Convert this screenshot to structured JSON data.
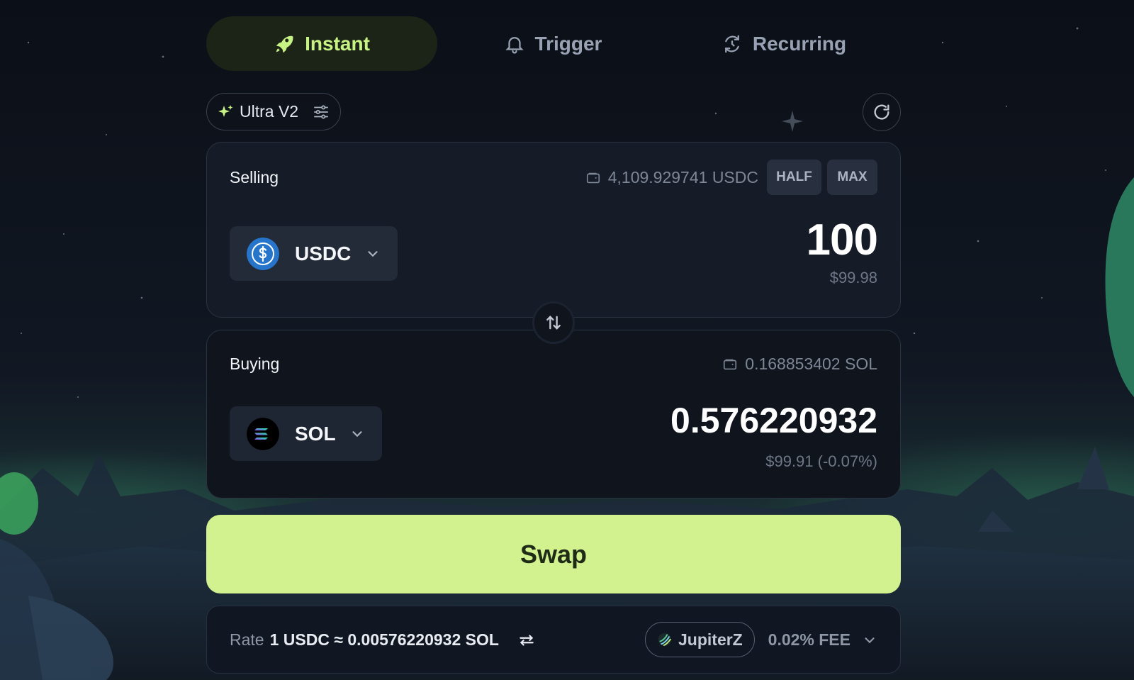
{
  "tabs": [
    {
      "label": "Instant",
      "icon": "rocket-icon",
      "active": true
    },
    {
      "label": "Trigger",
      "icon": "bell-icon",
      "active": false
    },
    {
      "label": "Recurring",
      "icon": "recurring-icon",
      "active": false
    }
  ],
  "mode": {
    "label": "Ultra V2",
    "icon": "sparkle-icon"
  },
  "selling": {
    "label": "Selling",
    "balance": "4,109.929741 USDC",
    "half_label": "HALF",
    "max_label": "MAX",
    "token": "USDC",
    "amount": "100",
    "usd_value": "$99.98"
  },
  "buying": {
    "label": "Buying",
    "balance": "0.168853402 SOL",
    "token": "SOL",
    "amount": "0.576220932",
    "usd_value": "$99.91 (-0.07%)"
  },
  "swap_button": {
    "label": "Swap"
  },
  "rate": {
    "label": "Rate",
    "value": "1 USDC ≈ 0.00576220932 SOL",
    "router": "JupiterZ",
    "fee": "0.02% FEE"
  },
  "colors": {
    "accent": "#c7f284",
    "swap_button": "#d1f28f",
    "background": "#0c1018",
    "panel": "#151b27"
  }
}
